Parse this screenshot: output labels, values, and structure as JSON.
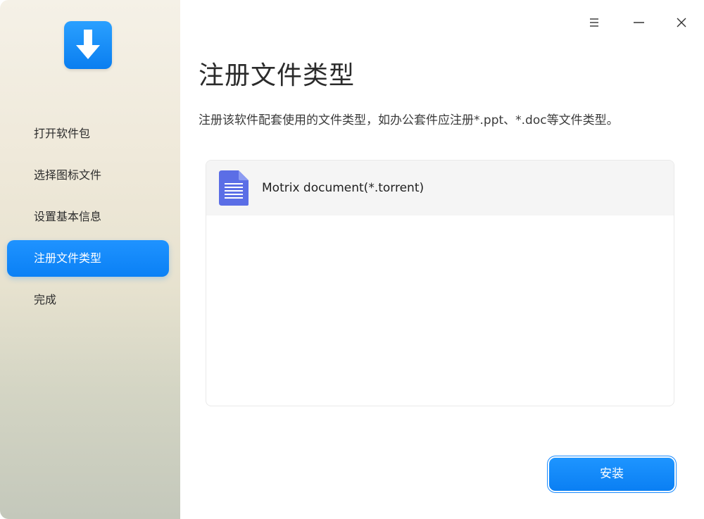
{
  "window": {
    "menu_icon": "hamburger-icon",
    "minimize_icon": "minimize-icon",
    "close_icon": "close-icon"
  },
  "sidebar": {
    "logo_icon": "download-arrow-icon",
    "items": [
      {
        "label": "打开软件包",
        "active": false
      },
      {
        "label": "选择图标文件",
        "active": false
      },
      {
        "label": "设置基本信息",
        "active": false
      },
      {
        "label": "注册文件类型",
        "active": true
      },
      {
        "label": "完成",
        "active": false
      }
    ]
  },
  "main": {
    "title": "注册文件类型",
    "description": "注册该软件配套使用的文件类型，如办公套件应注册*.ppt、*.doc等文件类型。",
    "file_types": [
      {
        "name": "Motrix document(*.torrent)",
        "icon": "document-icon"
      }
    ],
    "install_label": "安装"
  },
  "colors": {
    "accent": "#0a80f5",
    "doc_icon": "#5b6ee6"
  }
}
